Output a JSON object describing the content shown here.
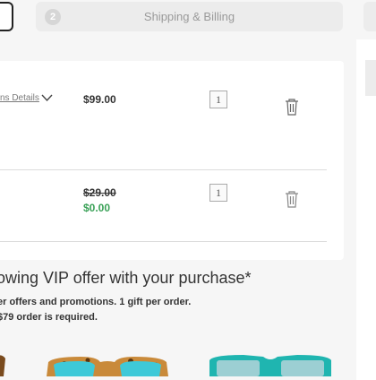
{
  "steps": {
    "active": {
      "label": ""
    },
    "next": {
      "number": "2",
      "label": "Shipping & Billing"
    }
  },
  "cart": {
    "items": [
      {
        "details_label": "ns Details",
        "price": "$99.00",
        "quantity": "1"
      },
      {
        "original_price": "$29.00",
        "price": "$0.00",
        "quantity": "1"
      }
    ]
  },
  "offer": {
    "title": "owing VIP offer with your purchase*",
    "line1": "er offers and promotions. 1 gift per order.",
    "line2": "$79 order is required."
  },
  "icons": {
    "chevron": "chevron-down-icon",
    "trash": "trash-icon"
  },
  "colors": {
    "free_price": "#3aa157",
    "step_bg": "#ececec",
    "lens_blue": "#3ec9d8",
    "tortoise": "#c98a3a",
    "teal_frame": "#1fb5b0"
  }
}
